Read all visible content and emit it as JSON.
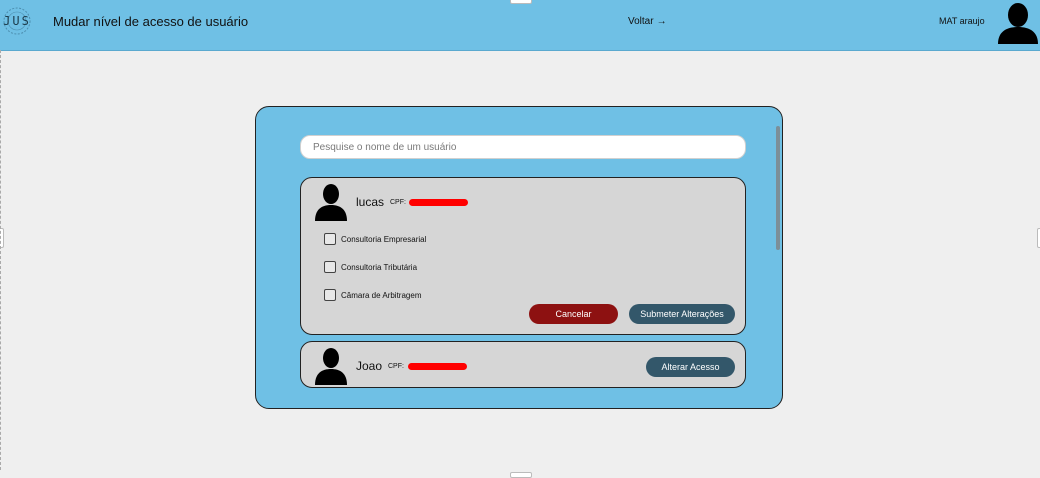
{
  "header": {
    "logo_text": "JUS",
    "title": "Mudar nível de acesso de usuário",
    "back_label": "Voltar",
    "back_arrow": "→",
    "user_name": "MAT araujo"
  },
  "search": {
    "placeholder": "Pesquise o nome de um usuário",
    "value": ""
  },
  "users": [
    {
      "name": "lucas",
      "cpf_label": "CPF:",
      "cpf_redacted": true,
      "expanded": true,
      "options": [
        {
          "label": "Consultoria Empresarial",
          "checked": false
        },
        {
          "label": "Consultoria Tributária",
          "checked": false
        },
        {
          "label": "Câmara de Arbitragem",
          "checked": false
        }
      ],
      "cancel_label": "Cancelar",
      "submit_label": "Submeter Alterações"
    },
    {
      "name": "Joao",
      "cpf_label": "CPF:",
      "cpf_redacted": true,
      "expanded": false,
      "alter_label": "Alterar Acesso"
    }
  ],
  "colors": {
    "header_bg": "#6fc0e5",
    "panel_bg": "#6fc0e5",
    "card_bg": "#d6d6d6",
    "cancel_btn": "#8d1111",
    "primary_btn": "#33576a",
    "redaction": "#ff0000"
  },
  "icons": [
    "logo-emblem-icon",
    "arrow-right-icon",
    "user-silhouette-icon"
  ]
}
